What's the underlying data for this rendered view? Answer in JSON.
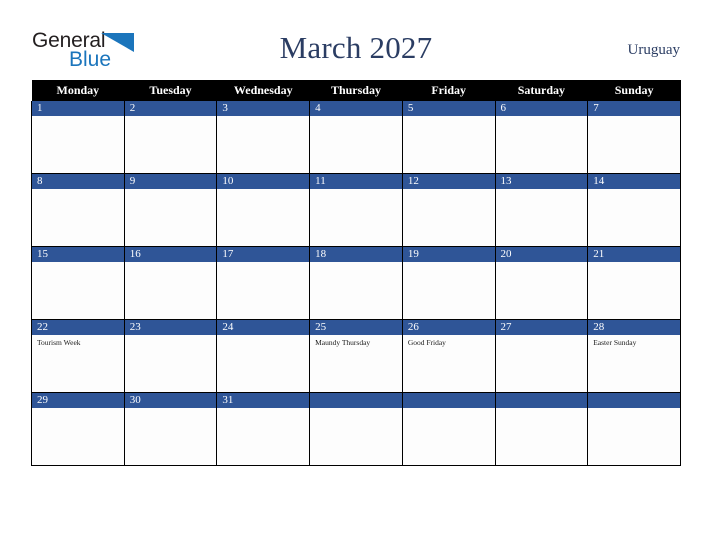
{
  "logo": {
    "word_one": "General",
    "word_two": "Blue",
    "triangle_icon": "triangle-icon",
    "accent_color": "#1b75bc"
  },
  "header": {
    "title": "March 2027",
    "country": "Uruguay",
    "title_color": "#2b3d63"
  },
  "calendar": {
    "header_background": "#000000",
    "day_band_color": "#2f5597",
    "weekday_headers": [
      "Monday",
      "Tuesday",
      "Wednesday",
      "Thursday",
      "Friday",
      "Saturday",
      "Sunday"
    ],
    "weeks": [
      [
        {
          "day": "1",
          "events": []
        },
        {
          "day": "2",
          "events": []
        },
        {
          "day": "3",
          "events": []
        },
        {
          "day": "4",
          "events": []
        },
        {
          "day": "5",
          "events": []
        },
        {
          "day": "6",
          "events": []
        },
        {
          "day": "7",
          "events": []
        }
      ],
      [
        {
          "day": "8",
          "events": []
        },
        {
          "day": "9",
          "events": []
        },
        {
          "day": "10",
          "events": []
        },
        {
          "day": "11",
          "events": []
        },
        {
          "day": "12",
          "events": []
        },
        {
          "day": "13",
          "events": []
        },
        {
          "day": "14",
          "events": []
        }
      ],
      [
        {
          "day": "15",
          "events": []
        },
        {
          "day": "16",
          "events": []
        },
        {
          "day": "17",
          "events": []
        },
        {
          "day": "18",
          "events": []
        },
        {
          "day": "19",
          "events": []
        },
        {
          "day": "20",
          "events": []
        },
        {
          "day": "21",
          "events": []
        }
      ],
      [
        {
          "day": "22",
          "events": [
            "Tourism Week"
          ]
        },
        {
          "day": "23",
          "events": []
        },
        {
          "day": "24",
          "events": []
        },
        {
          "day": "25",
          "events": [
            "Maundy Thursday"
          ]
        },
        {
          "day": "26",
          "events": [
            "Good Friday"
          ]
        },
        {
          "day": "27",
          "events": []
        },
        {
          "day": "28",
          "events": [
            "Easter Sunday"
          ]
        }
      ],
      [
        {
          "day": "29",
          "events": []
        },
        {
          "day": "30",
          "events": []
        },
        {
          "day": "31",
          "events": []
        },
        {
          "day": "",
          "events": []
        },
        {
          "day": "",
          "events": []
        },
        {
          "day": "",
          "events": []
        },
        {
          "day": "",
          "events": []
        }
      ]
    ]
  }
}
